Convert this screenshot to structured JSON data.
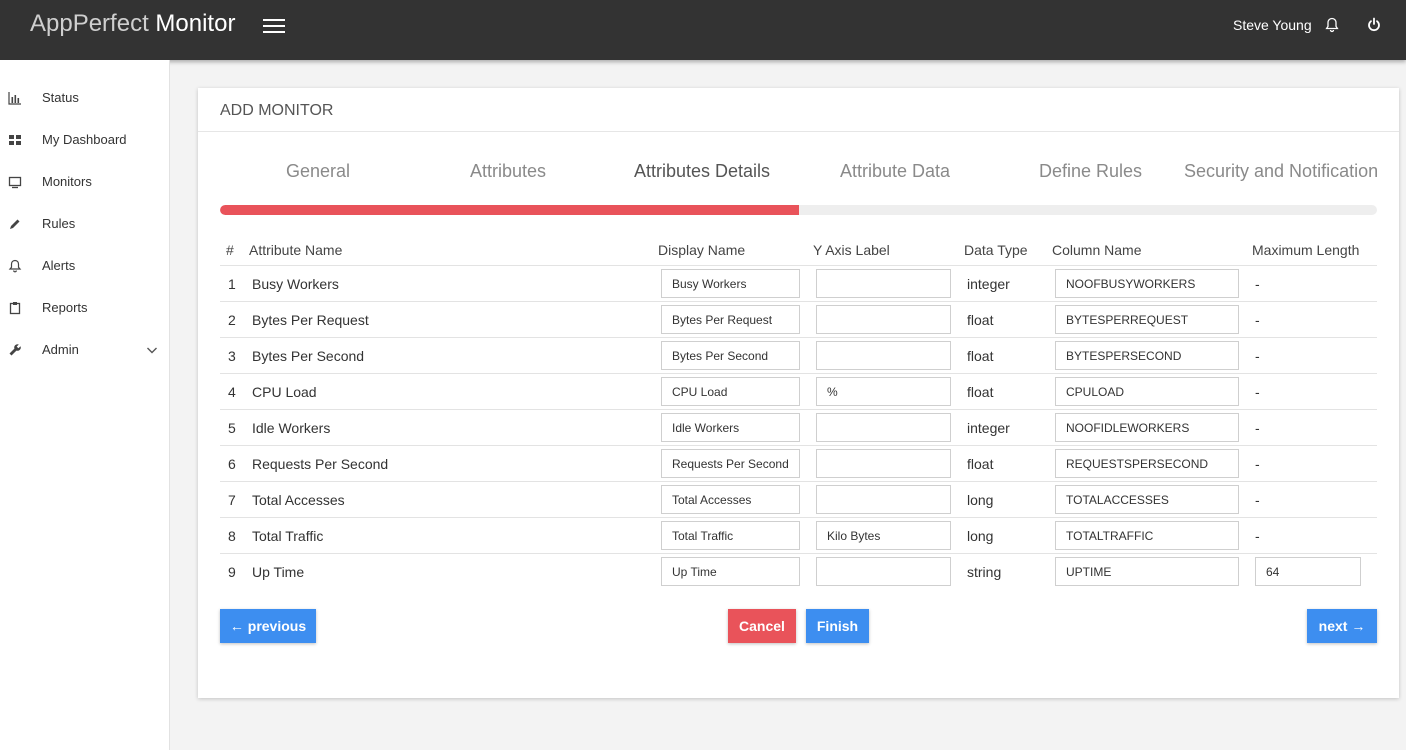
{
  "app": {
    "name_light": "AppPerfect",
    "name_bold": "Monitor"
  },
  "header": {
    "user_name": "Steve Young"
  },
  "sidebar": {
    "items": [
      {
        "label": "Status",
        "icon": "bar-chart-icon"
      },
      {
        "label": "My Dashboard",
        "icon": "dashboard-icon"
      },
      {
        "label": "Monitors",
        "icon": "monitor-icon"
      },
      {
        "label": "Rules",
        "icon": "pencil-icon"
      },
      {
        "label": "Alerts",
        "icon": "bell-icon"
      },
      {
        "label": "Reports",
        "icon": "clipboard-icon"
      },
      {
        "label": "Admin",
        "icon": "wrench-icon"
      }
    ]
  },
  "card": {
    "title": "ADD MONITOR"
  },
  "wizard": {
    "tabs": [
      {
        "label": "General"
      },
      {
        "label": "Attributes"
      },
      {
        "label": "Attributes Details"
      },
      {
        "label": "Attribute Data"
      },
      {
        "label": "Define Rules"
      },
      {
        "label": "Security and Notification"
      }
    ],
    "active_tab": "Attributes Details",
    "progress_percent": 50
  },
  "table": {
    "headers": {
      "num": "#",
      "attribute_name": "Attribute Name",
      "display_name": "Display Name",
      "y_axis_label": "Y Axis Label",
      "data_type": "Data Type",
      "column_name": "Column Name",
      "max_length": "Maximum Length"
    },
    "rows": [
      {
        "num": "1",
        "attribute_name": "Busy Workers",
        "display_name": "Busy Workers",
        "y_axis_label": "",
        "data_type": "integer",
        "column_name": "NOOFBUSYWORKERS",
        "max_length": "-"
      },
      {
        "num": "2",
        "attribute_name": "Bytes Per Request",
        "display_name": "Bytes Per Request",
        "y_axis_label": "",
        "data_type": "float",
        "column_name": "BYTESPERREQUEST",
        "max_length": "-"
      },
      {
        "num": "3",
        "attribute_name": "Bytes Per Second",
        "display_name": "Bytes Per Second",
        "y_axis_label": "",
        "data_type": "float",
        "column_name": "BYTESPERSECOND",
        "max_length": "-"
      },
      {
        "num": "4",
        "attribute_name": "CPU Load",
        "display_name": "CPU Load",
        "y_axis_label": "%",
        "data_type": "float",
        "column_name": "CPULOAD",
        "max_length": "-"
      },
      {
        "num": "5",
        "attribute_name": "Idle Workers",
        "display_name": "Idle Workers",
        "y_axis_label": "",
        "data_type": "integer",
        "column_name": "NOOFIDLEWORKERS",
        "max_length": "-"
      },
      {
        "num": "6",
        "attribute_name": "Requests Per Second",
        "display_name": "Requests Per Second",
        "y_axis_label": "",
        "data_type": "float",
        "column_name": "REQUESTSPERSECOND",
        "max_length": "-"
      },
      {
        "num": "7",
        "attribute_name": "Total Accesses",
        "display_name": "Total Accesses",
        "y_axis_label": "",
        "data_type": "long",
        "column_name": "TOTALACCESSES",
        "max_length": "-"
      },
      {
        "num": "8",
        "attribute_name": "Total Traffic",
        "display_name": "Total Traffic",
        "y_axis_label": "Kilo Bytes",
        "data_type": "long",
        "column_name": "TOTALTRAFFIC",
        "max_length": "-"
      },
      {
        "num": "9",
        "attribute_name": "Up Time",
        "display_name": "Up Time",
        "y_axis_label": "",
        "data_type": "string",
        "column_name": "UPTIME",
        "max_length": "64"
      }
    ]
  },
  "buttons": {
    "previous": "← previous",
    "cancel": "Cancel",
    "finish": "Finish",
    "next": "next →"
  },
  "colors": {
    "topbar": "#333333",
    "accent_red": "#e9535a",
    "accent_blue": "#3d8ef0"
  }
}
